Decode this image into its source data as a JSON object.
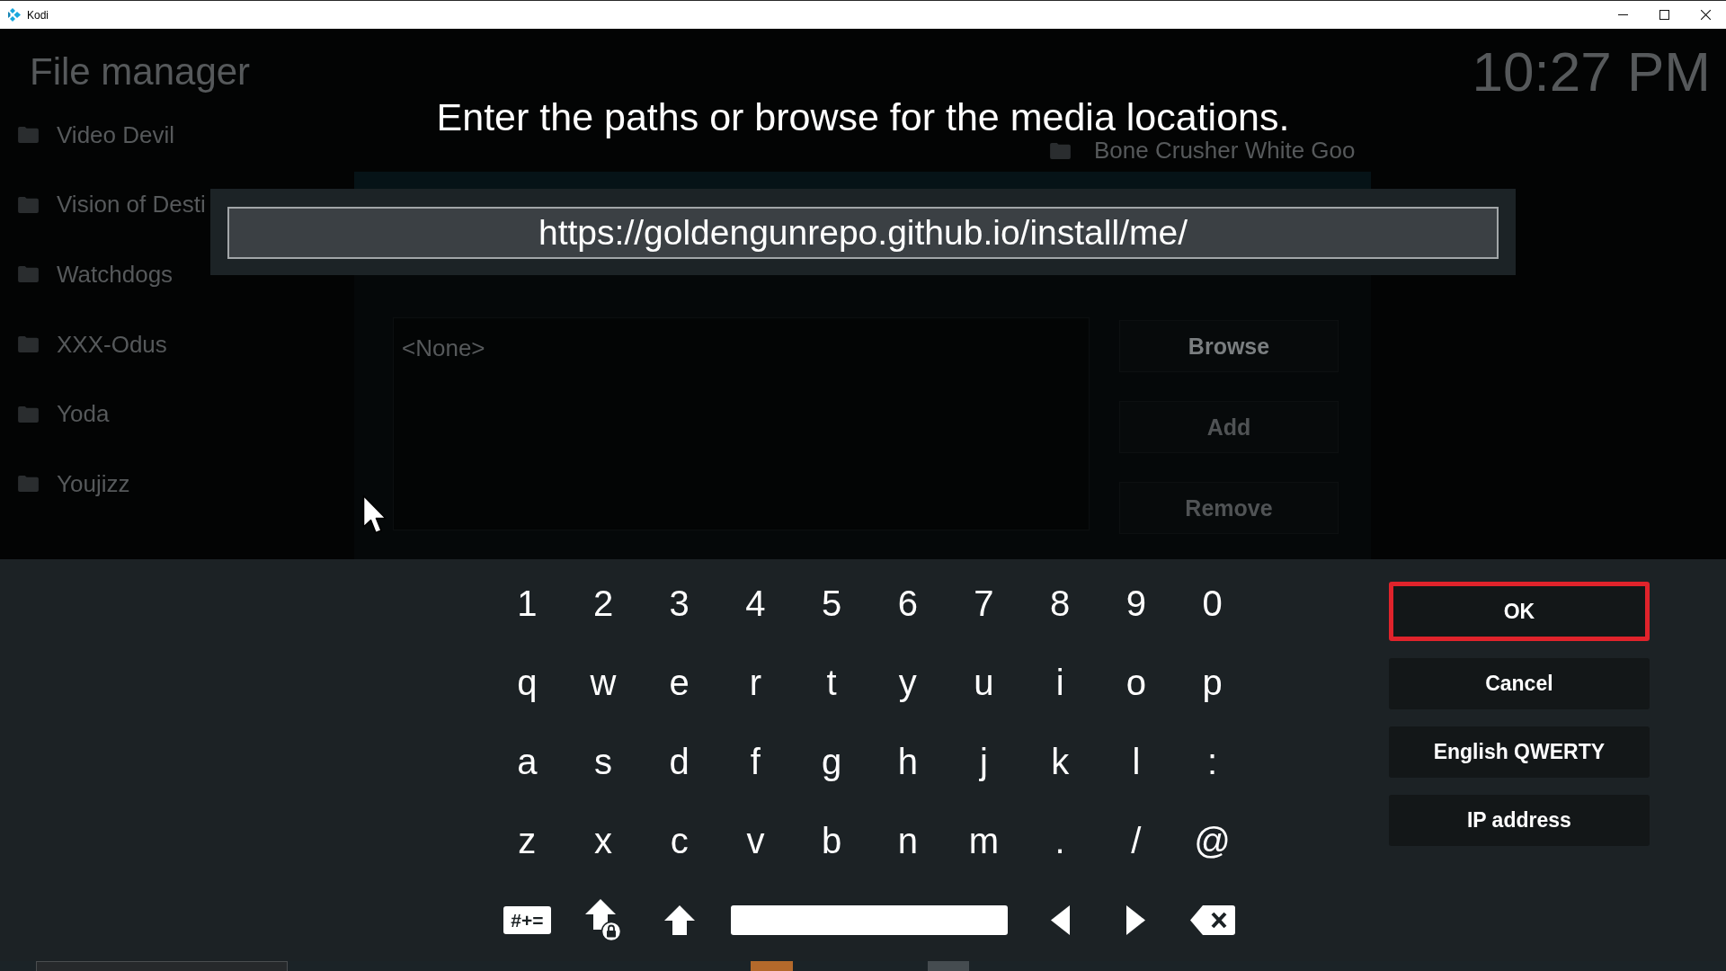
{
  "window": {
    "title": "Kodi"
  },
  "background": {
    "title": "File manager",
    "clock": "10:27 PM",
    "sources": [
      {
        "label": "Video Devil"
      },
      {
        "label": "Vision of Desti"
      },
      {
        "label": "Watchdogs"
      },
      {
        "label": "XXX-Odus"
      },
      {
        "label": "Yoda"
      },
      {
        "label": "Youjizz"
      }
    ],
    "side_item": {
      "label": "Bone Crusher White Goo"
    },
    "source_dialog": {
      "paths": "<None>",
      "buttons": [
        {
          "label": "Browse",
          "disabled": false
        },
        {
          "label": "Add",
          "disabled": true
        },
        {
          "label": "Remove",
          "disabled": true
        }
      ]
    }
  },
  "prompt": "Enter the paths or browse for the media locations.",
  "input": {
    "value": "https://goldengunrepo.github.io/install/me/"
  },
  "keyboard": {
    "rows": [
      [
        "1",
        "2",
        "3",
        "4",
        "5",
        "6",
        "7",
        "8",
        "9",
        "0"
      ],
      [
        "q",
        "w",
        "e",
        "r",
        "t",
        "y",
        "u",
        "i",
        "o",
        "p"
      ],
      [
        "a",
        "s",
        "d",
        "f",
        "g",
        "h",
        "j",
        "k",
        "l",
        ":"
      ],
      [
        "z",
        "x",
        "c",
        "v",
        "b",
        "n",
        "m",
        ".",
        "/",
        "@"
      ]
    ],
    "controls": [
      {
        "kind": "symbols",
        "label": "#+="
      },
      {
        "kind": "caps_lock"
      },
      {
        "kind": "shift"
      },
      {
        "kind": "space"
      },
      {
        "kind": "left"
      },
      {
        "kind": "right"
      },
      {
        "kind": "backspace"
      }
    ]
  },
  "actions": [
    {
      "label": "OK",
      "selected": true
    },
    {
      "label": "Cancel",
      "selected": false
    },
    {
      "label": "English QWERTY",
      "selected": false
    },
    {
      "label": "IP address",
      "selected": false
    }
  ]
}
